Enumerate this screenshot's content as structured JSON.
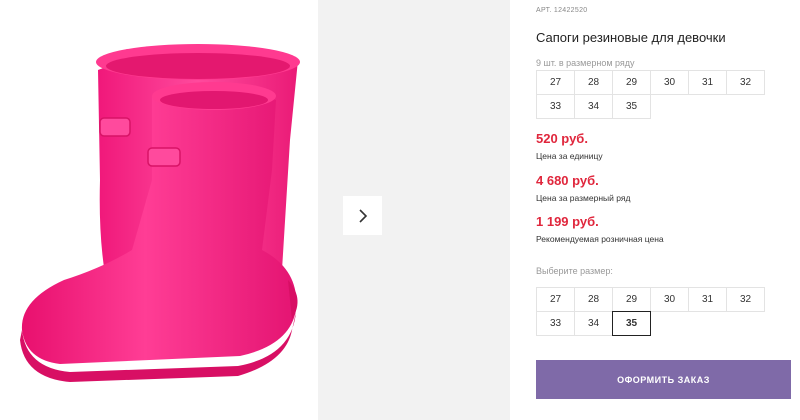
{
  "product": {
    "sku": "АРТ. 12422520",
    "title": "Сапоги резиновые для девочки",
    "row_note": "9 шт. в размерном ряду",
    "row_sizes": [
      "27",
      "28",
      "29",
      "30",
      "31",
      "32",
      "33",
      "34",
      "35"
    ]
  },
  "prices": [
    {
      "amount": "520 руб.",
      "label": "Цена за единицу"
    },
    {
      "amount": "4 680 руб.",
      "label": "Цена за размерный ряд"
    },
    {
      "amount": "1 199 руб.",
      "label": "Рекомендуемая розничная цена"
    }
  ],
  "size_picker": {
    "label": "Выберите размер:",
    "sizes": [
      "27",
      "28",
      "29",
      "30",
      "31",
      "32",
      "33",
      "34",
      "35"
    ],
    "selected": "35"
  },
  "order_button_label": "ОФОРМИТЬ ЗАКАЗ",
  "colors": {
    "price": "#e0263c",
    "button": "#7f6aa8",
    "boot": "#ff2a8a"
  },
  "icons": {
    "next": "chevron-right-icon"
  }
}
